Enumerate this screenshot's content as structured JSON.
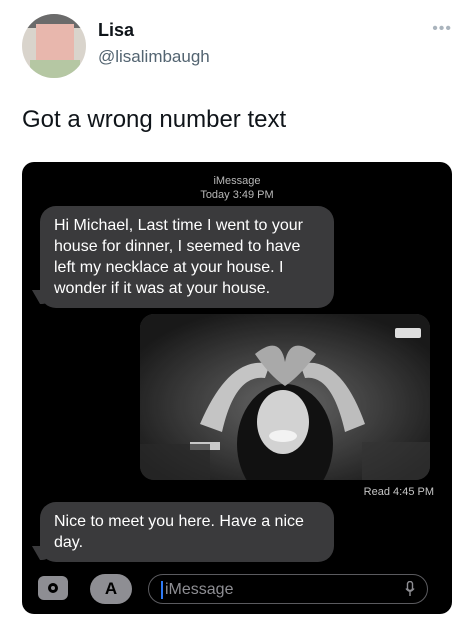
{
  "tweet": {
    "name": "Lisa",
    "handle": "@lisalimbaugh",
    "text": "Got a wrong number text",
    "more_icon": "•••"
  },
  "imessage": {
    "service": "iMessage",
    "timestamp": "Today 3:49 PM",
    "messages": [
      {
        "text": "Hi Michael, Last time I went to your house for dinner, I seemed to have left my necklace at your house. I wonder if it was at your house."
      },
      {
        "text": "Nice to meet you here. Have a nice day."
      }
    ],
    "read_receipt": "Read 4:45 PM",
    "input_placeholder": "iMessage",
    "app_store_glyph": "A"
  },
  "colors": {
    "bubble": "#3a3a3c",
    "screen": "#000000",
    "caret": "#2f7bf6"
  }
}
